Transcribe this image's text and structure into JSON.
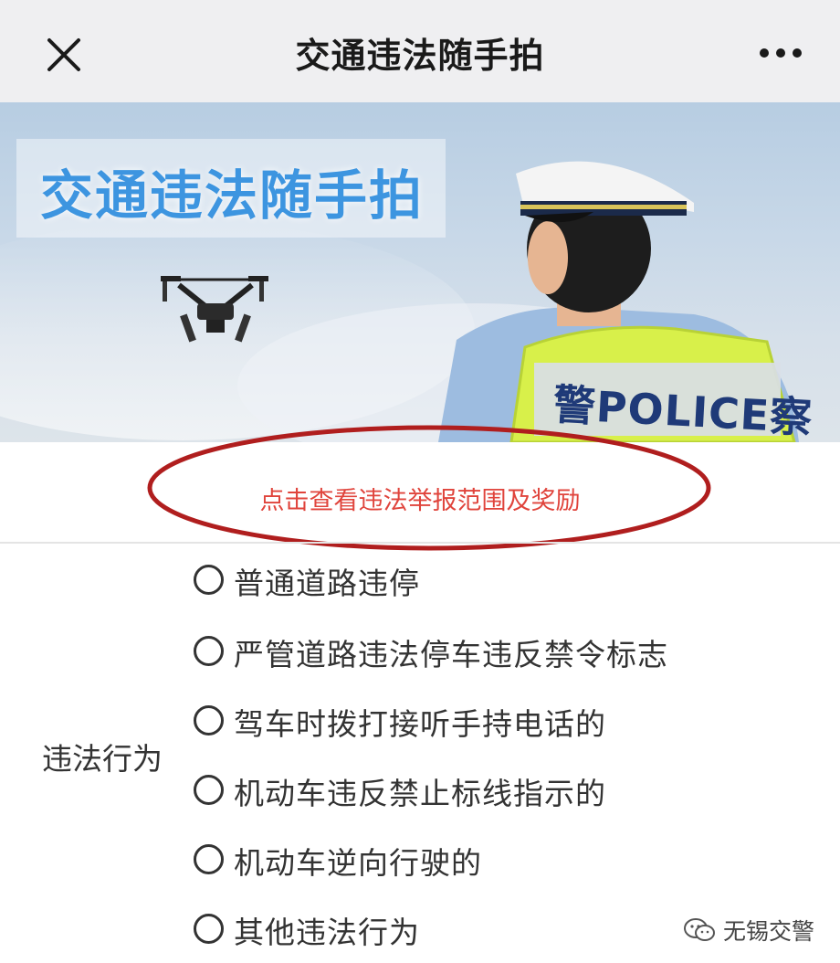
{
  "nav": {
    "title": "交通违法随手拍",
    "close_icon": "close-icon",
    "more_icon": "more-dots-icon"
  },
  "banner": {
    "title": "交通违法随手拍",
    "vest_text": "警POLICE察",
    "colors": {
      "title": "#3d95e0",
      "vest": "#d8f04a"
    }
  },
  "rules_link": {
    "label": "点击查看违法举报范围及奖励",
    "color": "#e0443c",
    "highlight_color": "#b01e1e"
  },
  "form": {
    "label": "违法行为",
    "options": [
      {
        "label": "普通道路违停",
        "selected": false
      },
      {
        "label": "严管道路违法停车违反禁令标志",
        "selected": false
      },
      {
        "label": "驾车时拨打接听手持电话的",
        "selected": false
      },
      {
        "label": "机动车违反禁止标线指示的",
        "selected": false
      },
      {
        "label": "机动车逆向行驶的",
        "selected": false
      },
      {
        "label": "其他违法行为",
        "selected": false
      }
    ]
  },
  "watermark": {
    "text": "无锡交警",
    "icon": "wechat-icon"
  }
}
